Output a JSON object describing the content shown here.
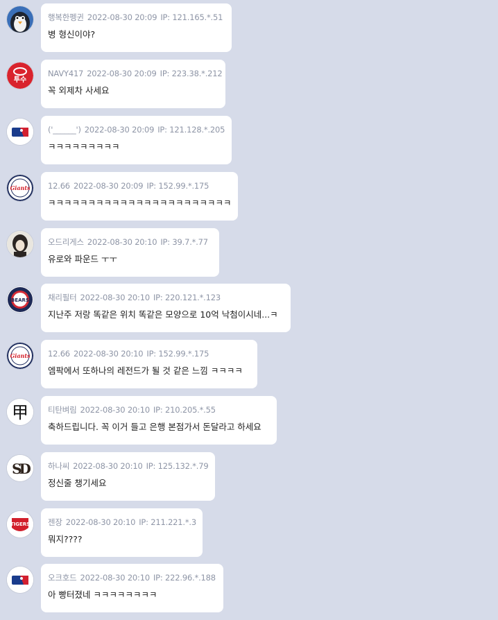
{
  "comments": [
    {
      "nickname": "행복한펭귄",
      "datetime": "2022-08-30 20:09",
      "ip": "IP: 121.165.*.51",
      "text": "병 형신이야?",
      "avatar_icon": "penguin-icon"
    },
    {
      "nickname": "NAVY417",
      "datetime": "2022-08-30 20:09",
      "ip": "IP: 223.38.*.212",
      "text": "꼭 외제차 사세요",
      "avatar_icon": "team-logo-red-icon"
    },
    {
      "nickname": "('______')",
      "datetime": "2022-08-30 20:09",
      "ip": "IP: 121.128.*.205",
      "text": "ㅋㅋㅋㅋㅋㅋㅋㅋㅋ",
      "avatar_icon": "mlb-logo-icon"
    },
    {
      "nickname": "12.66",
      "datetime": "2022-08-30 20:09",
      "ip": "IP: 152.99.*.175",
      "text": "ㅋㅋㅋㅋㅋㅋㅋㅋㅋㅋㅋㅋㅋㅋㅋㅋㅋㅋㅋㅋㅋㅋㅋ",
      "avatar_icon": "giants-logo-icon"
    },
    {
      "nickname": "오드리게스",
      "datetime": "2022-08-30 20:10",
      "ip": "IP: 39.7.*.77",
      "text": "유로와 파운드 ㅜㅜ",
      "avatar_icon": "portrait-icon"
    },
    {
      "nickname": "채리필터",
      "datetime": "2022-08-30 20:10",
      "ip": "IP: 220.121.*.123",
      "text": "지난주 저랑 똑같은 위치 똑같은 모양으로 10억 낙첨이시네...ㅋ",
      "avatar_icon": "bears-logo-icon"
    },
    {
      "nickname": "12.66",
      "datetime": "2022-08-30 20:10",
      "ip": "IP: 152.99.*.175",
      "text": "엠팍에서 또하나의 레전드가 될 것 같은 느낌 ㅋㅋㅋㅋ",
      "avatar_icon": "giants-logo-icon"
    },
    {
      "nickname": "티탄벼림",
      "datetime": "2022-08-30 20:10",
      "ip": "IP: 210.205.*.55",
      "text": "축하드립니다. 꼭 이거 들고 은행 본점가서 돈달라고 하세요",
      "avatar_icon": "kanji-icon"
    },
    {
      "nickname": "하나씨",
      "datetime": "2022-08-30 20:10",
      "ip": "IP: 125.132.*.79",
      "text": "정신줄 챙기세요",
      "avatar_icon": "sd-logo-icon"
    },
    {
      "nickname": "젠장",
      "datetime": "2022-08-30 20:10",
      "ip": "IP: 211.221.*.3",
      "text": "뭐지????",
      "avatar_icon": "tigers-logo-icon"
    },
    {
      "nickname": "오크호드",
      "datetime": "2022-08-30 20:10",
      "ip": "IP: 222.96.*.188",
      "text": "아 빵터졌네 ㅋㅋㅋㅋㅋㅋㅋㅋ",
      "avatar_icon": "mlb-logo-icon"
    }
  ],
  "avatar_kanji": "甲",
  "avatar_red_text": "투수",
  "avatar_bears_text": "BEARS",
  "avatar_giants_text": "Giants",
  "avatar_tigers_text": "TIGERS",
  "avatar_sd_text": "SD"
}
